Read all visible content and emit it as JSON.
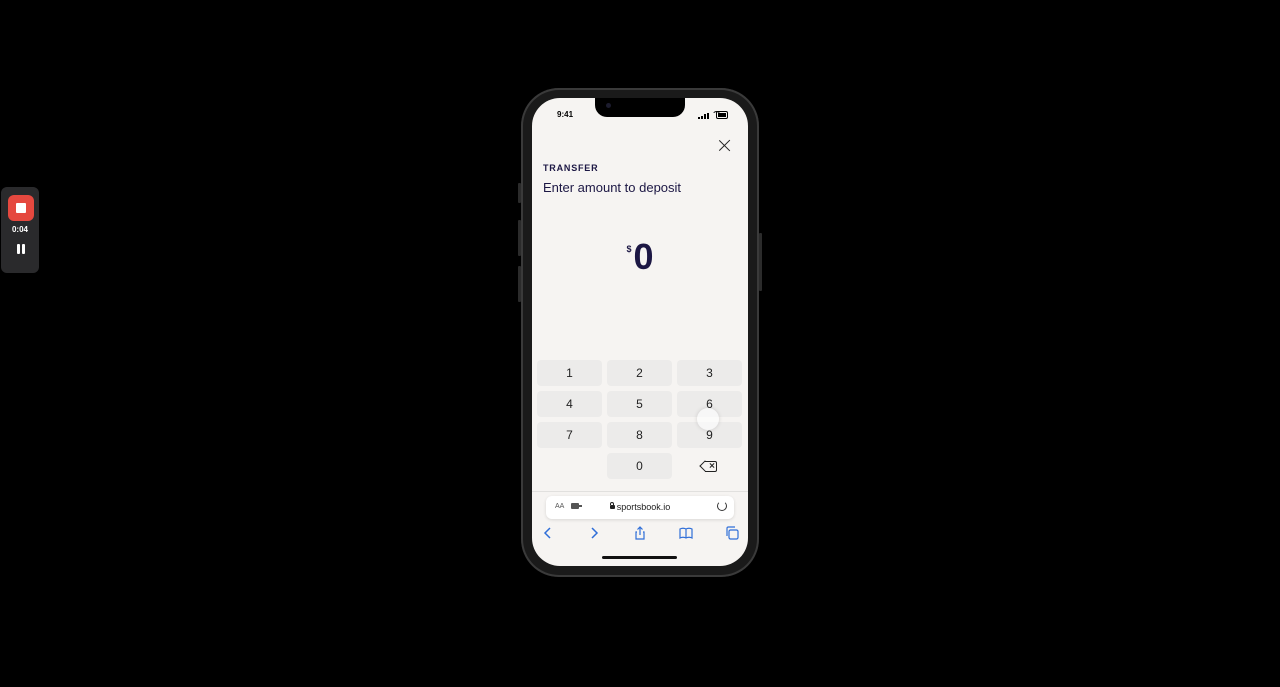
{
  "recorder": {
    "elapsed": "0:04"
  },
  "status_bar": {
    "time": "9:41"
  },
  "transfer": {
    "section_label": "TRANSFER",
    "heading": "Enter amount to deposit",
    "currency_symbol": "$",
    "amount": "0"
  },
  "keypad": {
    "keys": [
      "1",
      "2",
      "3",
      "4",
      "5",
      "6",
      "7",
      "8",
      "9",
      "0"
    ]
  },
  "browser": {
    "text_size_label": "AA",
    "url": "sportsbook.io",
    "toolbar_icons": [
      "back-icon",
      "forward-icon",
      "share-icon",
      "bookmarks-icon",
      "tabs-icon"
    ]
  },
  "colors": {
    "accent": "#1c1744",
    "link": "#2f6ed8",
    "record": "#e5483f"
  }
}
